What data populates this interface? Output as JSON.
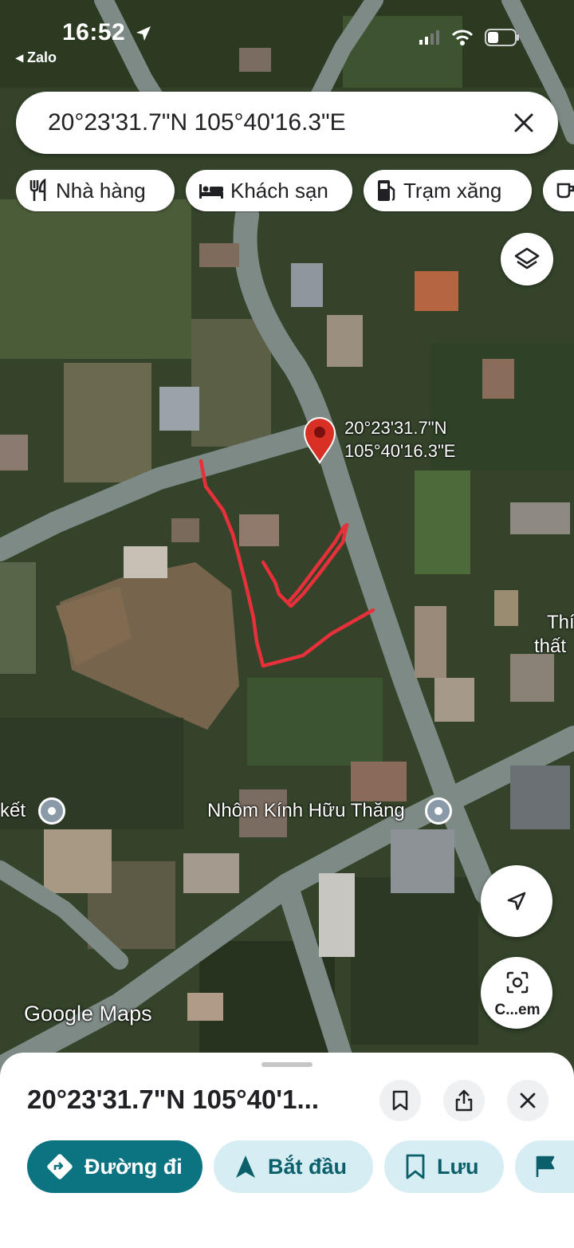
{
  "status_bar": {
    "time": "16:52",
    "back_app": "◂ Zalo"
  },
  "search": {
    "query": "20°23'31.7\"N 105°40'16.3\"E"
  },
  "chips": [
    {
      "label": "Nhà hàng",
      "icon": "restaurant-icon"
    },
    {
      "label": "Khách sạn",
      "icon": "hotel-icon"
    },
    {
      "label": "Trạm xăng",
      "icon": "gas-station-icon"
    }
  ],
  "map": {
    "pin_label_line1": "20°23'31.7\"N",
    "pin_label_line2": "105°40'16.3\"E",
    "poi_right": "Nhôm Kính Hữu Thăng",
    "poi_left": "kết",
    "edge_label_line1": "Thí",
    "edge_label_line2": "thất",
    "attribution": "Google Maps",
    "drawing_color": "#e8303a",
    "pin_color": "#d93025"
  },
  "lens": {
    "label": "C...em"
  },
  "sheet": {
    "title": "20°23'31.7\"N 105°40'1...",
    "actions": [
      {
        "label": "Đường đi",
        "icon": "directions-icon"
      },
      {
        "label": "Bắt đầu",
        "icon": "navigation-arrow-icon"
      },
      {
        "label": "Lưu",
        "icon": "bookmark-icon"
      }
    ]
  },
  "colors": {
    "primary_button": "#0b7480",
    "secondary_button": "#d6eef3"
  }
}
